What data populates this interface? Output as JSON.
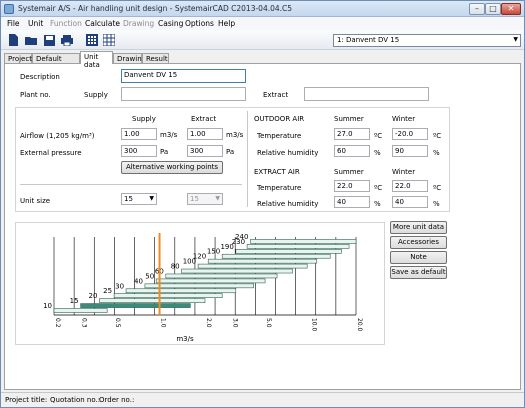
{
  "window": {
    "title": "Systemair A/S - Air handling unit design - SystemairCAD C2013-04.04.C5"
  },
  "menu": [
    {
      "label": "File",
      "enabled": true
    },
    {
      "label": "Unit",
      "enabled": true
    },
    {
      "label": "Function",
      "enabled": false
    },
    {
      "label": "Calculate",
      "enabled": true
    },
    {
      "label": "Drawing",
      "enabled": false
    },
    {
      "label": "Casing",
      "enabled": true
    },
    {
      "label": "Options",
      "enabled": true
    },
    {
      "label": "Help",
      "enabled": true
    }
  ],
  "toolbar": {
    "icons": [
      "new-document-icon",
      "open-folder-icon",
      "save-icon",
      "print-icon",
      "calculator-icon",
      "grid-icon"
    ],
    "unit_select": "1: Danvent DV 15"
  },
  "tabs": [
    "Project",
    "Default values",
    "Unit data",
    "Drawing",
    "Result"
  ],
  "active_tab": "Unit data",
  "form": {
    "description_label": "Description",
    "description_value": "Danvent DV 15",
    "plant_no_label": "Plant no.",
    "supply_label": "Supply",
    "supply_value": "",
    "extract_label": "Extract",
    "extract_value": ""
  },
  "airflow": {
    "supply_header": "Supply",
    "extract_header": "Extract",
    "airflow_label": "Airflow (1,205 kg/m³)",
    "airflow_supply": "1.00",
    "airflow_extract": "1.00",
    "airflow_unit": "m3/s",
    "pressure_label": "External pressure",
    "pressure_supply": "300",
    "pressure_extract": "300",
    "pressure_unit": "Pa",
    "alt_button": "Alternative working points",
    "unit_size_label": "Unit size",
    "unit_size_value": "15",
    "unit_size_disabled_value": "15"
  },
  "outdoor": {
    "header": "OUTDOOR AIR",
    "summer_header": "Summer",
    "winter_header": "Winter",
    "temp_label": "Temperature",
    "temp_summer": "27.0",
    "temp_winter": "-20.0",
    "temp_unit": "ºC",
    "rh_label": "Relative humidity",
    "rh_summer": "60",
    "rh_winter": "90",
    "rh_unit": "%"
  },
  "extract_air": {
    "header": "EXTRACT AIR",
    "summer_header": "Summer",
    "winter_header": "Winter",
    "temp_label": "Temperature",
    "temp_summer": "22.0",
    "temp_winter": "22.0",
    "temp_unit": "ºC",
    "rh_label": "Relative humidity",
    "rh_summer": "40",
    "rh_winter": "40",
    "rh_unit": "%"
  },
  "side_buttons": [
    "More unit data",
    "Accessories",
    "Note",
    "Save as default"
  ],
  "chart_data": {
    "type": "bar",
    "xlabel": "m3/s",
    "x_scale": "log",
    "xlim": [
      0.2,
      20
    ],
    "x_ticks": [
      "0.2",
      "0.3",
      "0.5",
      "1.0",
      "2.0",
      "3.0",
      "5.0",
      "10.0",
      "20.0"
    ],
    "marker_x": 1.0,
    "sizes": [
      {
        "label": "10",
        "min": 0.2,
        "max": 0.45,
        "highlight": false
      },
      {
        "label": "15",
        "min": 0.3,
        "max": 1.6,
        "highlight": true
      },
      {
        "label": "20",
        "min": 0.4,
        "max": 2.0,
        "highlight": false
      },
      {
        "label": "25",
        "min": 0.5,
        "max": 2.6,
        "highlight": false
      },
      {
        "label": "30",
        "min": 0.6,
        "max": 3.2,
        "highlight": false
      },
      {
        "label": "40",
        "min": 0.8,
        "max": 4.2,
        "highlight": false
      },
      {
        "label": "50",
        "min": 0.95,
        "max": 5.0,
        "highlight": false
      },
      {
        "label": "60",
        "min": 1.1,
        "max": 6.0,
        "highlight": false
      },
      {
        "label": "80",
        "min": 1.4,
        "max": 7.6,
        "highlight": false
      },
      {
        "label": "100",
        "min": 1.8,
        "max": 9.5,
        "highlight": false
      },
      {
        "label": "120",
        "min": 2.1,
        "max": 11.0,
        "highlight": false
      },
      {
        "label": "150",
        "min": 2.6,
        "max": 13.5,
        "highlight": false
      },
      {
        "label": "190",
        "min": 3.2,
        "max": 16.0,
        "highlight": false
      },
      {
        "label": "230",
        "min": 3.8,
        "max": 18.0,
        "highlight": false
      },
      {
        "label": "240",
        "min": 4.0,
        "max": 20.0,
        "highlight": false
      }
    ]
  },
  "status": {
    "project_title_label": "Project title:",
    "quotation_label": "Quotation no.:",
    "order_label": "Order no.:"
  }
}
